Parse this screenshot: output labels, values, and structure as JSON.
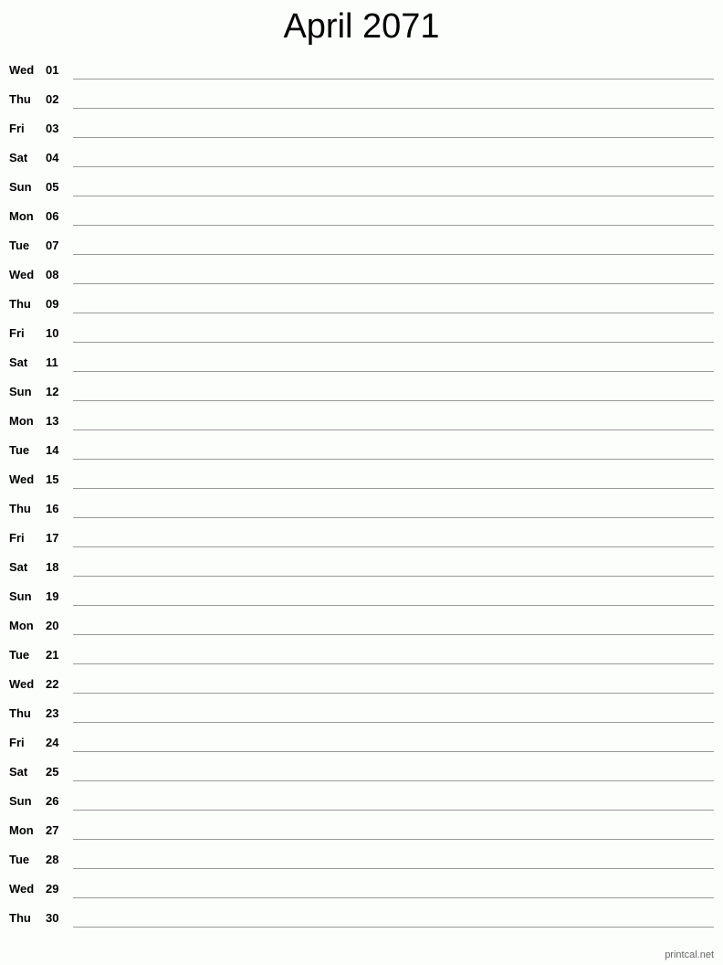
{
  "title": "April 2071",
  "footer": "printcal.net",
  "days": [
    {
      "dow": "Wed",
      "day": "01"
    },
    {
      "dow": "Thu",
      "day": "02"
    },
    {
      "dow": "Fri",
      "day": "03"
    },
    {
      "dow": "Sat",
      "day": "04"
    },
    {
      "dow": "Sun",
      "day": "05"
    },
    {
      "dow": "Mon",
      "day": "06"
    },
    {
      "dow": "Tue",
      "day": "07"
    },
    {
      "dow": "Wed",
      "day": "08"
    },
    {
      "dow": "Thu",
      "day": "09"
    },
    {
      "dow": "Fri",
      "day": "10"
    },
    {
      "dow": "Sat",
      "day": "11"
    },
    {
      "dow": "Sun",
      "day": "12"
    },
    {
      "dow": "Mon",
      "day": "13"
    },
    {
      "dow": "Tue",
      "day": "14"
    },
    {
      "dow": "Wed",
      "day": "15"
    },
    {
      "dow": "Thu",
      "day": "16"
    },
    {
      "dow": "Fri",
      "day": "17"
    },
    {
      "dow": "Sat",
      "day": "18"
    },
    {
      "dow": "Sun",
      "day": "19"
    },
    {
      "dow": "Mon",
      "day": "20"
    },
    {
      "dow": "Tue",
      "day": "21"
    },
    {
      "dow": "Wed",
      "day": "22"
    },
    {
      "dow": "Thu",
      "day": "23"
    },
    {
      "dow": "Fri",
      "day": "24"
    },
    {
      "dow": "Sat",
      "day": "25"
    },
    {
      "dow": "Sun",
      "day": "26"
    },
    {
      "dow": "Mon",
      "day": "27"
    },
    {
      "dow": "Tue",
      "day": "28"
    },
    {
      "dow": "Wed",
      "day": "29"
    },
    {
      "dow": "Thu",
      "day": "30"
    }
  ]
}
